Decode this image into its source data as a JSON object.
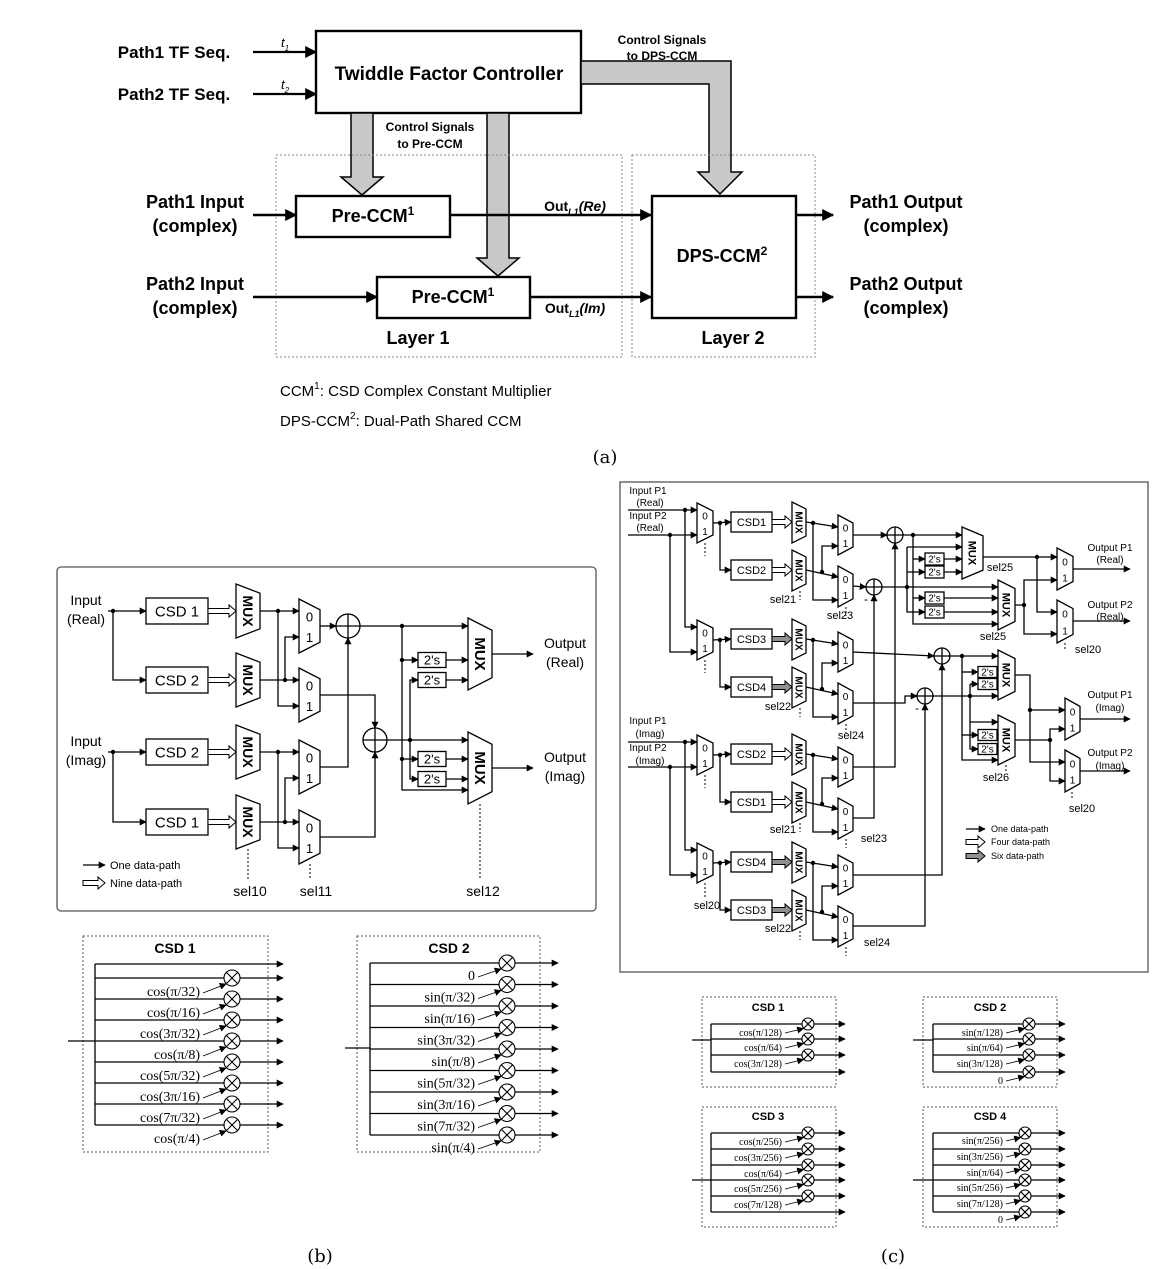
{
  "panel_a": {
    "caption": "(a)",
    "tf_seq": [
      "Path1 TF Seq.",
      "Path2 TF Seq."
    ],
    "t_labels": [
      {
        "base": "t",
        "sub": "1"
      },
      {
        "base": "t",
        "sub": "2"
      }
    ],
    "controller": "Twiddle Factor Controller",
    "ctrl_dps": [
      "Control Signals",
      "to DPS-CCM"
    ],
    "ctrl_pre": [
      "Control Signals",
      "to Pre-CCM"
    ],
    "inputs": [
      [
        "Path1 Input",
        "(complex)"
      ],
      [
        "Path2 Input",
        "(complex)"
      ]
    ],
    "pre_ccm": {
      "label": "Pre-CCM",
      "sup": "1"
    },
    "out_re": {
      "base": "Out",
      "sub": "L1",
      "suffix": "(Re)"
    },
    "out_im": {
      "base": "Out",
      "sub": "L1",
      "suffix": "(Im)"
    },
    "dps_ccm": {
      "label": "DPS-CCM",
      "sup": "2"
    },
    "outputs": [
      [
        "Path1 Output",
        "(complex)"
      ],
      [
        "Path2 Output",
        "(complex)"
      ]
    ],
    "layers": [
      "Layer 1",
      "Layer 2"
    ],
    "notes": [
      {
        "term": "CCM",
        "sup": "1",
        "text": ": CSD Complex Constant Multiplier"
      },
      {
        "term": "DPS-CCM",
        "sup": "2",
        "text": ": Dual-Path Shared CCM"
      }
    ]
  },
  "panel_b": {
    "caption": "(b)",
    "inputs": [
      [
        "Input",
        "(Real)"
      ],
      [
        "Input",
        "(Imag)"
      ]
    ],
    "csd_blocks": [
      "CSD 1",
      "CSD 2",
      "CSD 2",
      "CSD 1"
    ],
    "mux_label": "MUX",
    "sel_mux_inputs": [
      "0",
      "1"
    ],
    "twos": "2's",
    "outputs": [
      [
        "Output",
        "(Real)"
      ],
      [
        "Output",
        "(Imag)"
      ]
    ],
    "sel_labels": [
      "sel10",
      "sel11",
      "sel12"
    ],
    "legend": [
      "One data-path",
      "Nine data-path"
    ],
    "tables": [
      {
        "title": "CSD 1",
        "coefficients": [
          "cos(π/32)",
          "cos(π/16)",
          "cos(3π/32)",
          "cos(π/8)",
          "cos(5π/32)",
          "cos(3π/16)",
          "cos(7π/32)",
          "cos(π/4)"
        ]
      },
      {
        "title": "CSD 2",
        "coefficients": [
          "0",
          "sin(π/32)",
          "sin(π/16)",
          "sin(3π/32)",
          "sin(π/8)",
          "sin(5π/32)",
          "sin(3π/16)",
          "sin(7π/32)",
          "sin(π/4)"
        ]
      }
    ]
  },
  "panel_c": {
    "caption": "(c)",
    "inputs": [
      [
        "Input P1",
        "(Real)"
      ],
      [
        "Input P2",
        "(Real)"
      ],
      [
        "Input P1",
        "(Imag)"
      ],
      [
        "Input P2",
        "(Imag)"
      ]
    ],
    "csd_blocks": [
      "CSD1",
      "CSD2",
      "CSD3",
      "CSD4",
      "CSD2",
      "CSD1",
      "CSD4",
      "CSD3"
    ],
    "mux_label": "MUX",
    "sel_mux_inputs": [
      "0",
      "1"
    ],
    "twos": "2's",
    "minus": "-",
    "outputs": [
      [
        "Output P1",
        "(Real)"
      ],
      [
        "Output P2",
        "(Real)"
      ],
      [
        "Output P1",
        "(Imag)"
      ],
      [
        "Output P2",
        "(Imag)"
      ]
    ],
    "sel_labels": [
      "sel21",
      "sel23",
      "sel22",
      "sel24",
      "sel21",
      "sel23",
      "sel22",
      "sel24",
      "sel20",
      "sel25",
      "sel25",
      "sel20",
      "sel26",
      "sel20"
    ],
    "legend": [
      "One data-path",
      "Four data-path",
      "Six data-path"
    ],
    "tables": [
      {
        "title": "CSD 1",
        "coefficients": [
          "cos(π/128)",
          "cos(π/64)",
          "cos(3π/128)"
        ]
      },
      {
        "title": "CSD 2",
        "coefficients": [
          "sin(π/128)",
          "sin(π/64)",
          "sin(3π/128)",
          "0"
        ]
      },
      {
        "title": "CSD 3",
        "coefficients": [
          "cos(π/256)",
          "cos(3π/256)",
          "cos(π/64)",
          "cos(5π/256)",
          "cos(7π/128)"
        ]
      },
      {
        "title": "CSD 4",
        "coefficients": [
          "sin(π/256)",
          "sin(3π/256)",
          "sin(π/64)",
          "sin(5π/256)",
          "sin(7π/128)",
          "0"
        ]
      }
    ]
  },
  "colors": {
    "line": "#000000",
    "control_arrow_fill": "#c8c8c8",
    "six_path_fill": "#909090",
    "frame": "#555555"
  }
}
